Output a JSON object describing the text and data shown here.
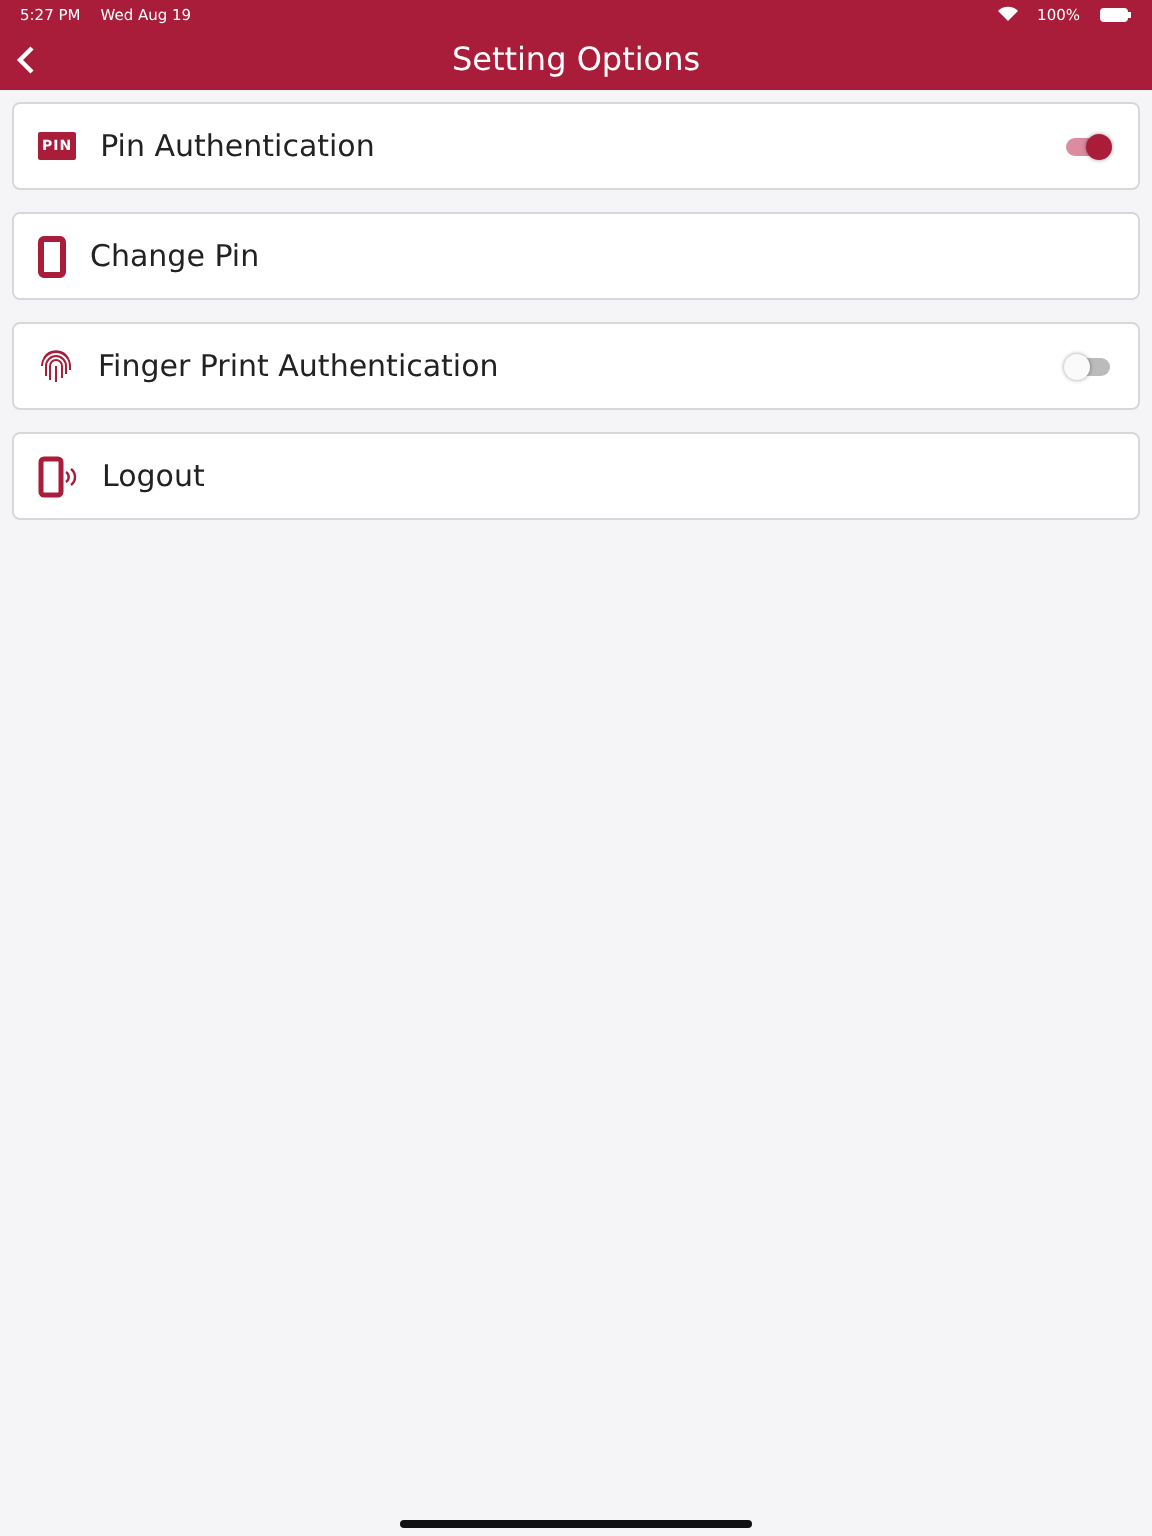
{
  "status_bar": {
    "time": "5:27 PM",
    "date": "Wed Aug 19",
    "battery": "100%"
  },
  "header": {
    "title": "Setting Options"
  },
  "options": [
    {
      "label": "Pin Authentication",
      "icon_text": "PIN",
      "kind": "toggle",
      "on": true
    },
    {
      "label": "Change Pin",
      "kind": "link"
    },
    {
      "label": "Finger Print Authentication",
      "kind": "toggle",
      "on": false
    },
    {
      "label": "Logout",
      "kind": "link"
    }
  ]
}
